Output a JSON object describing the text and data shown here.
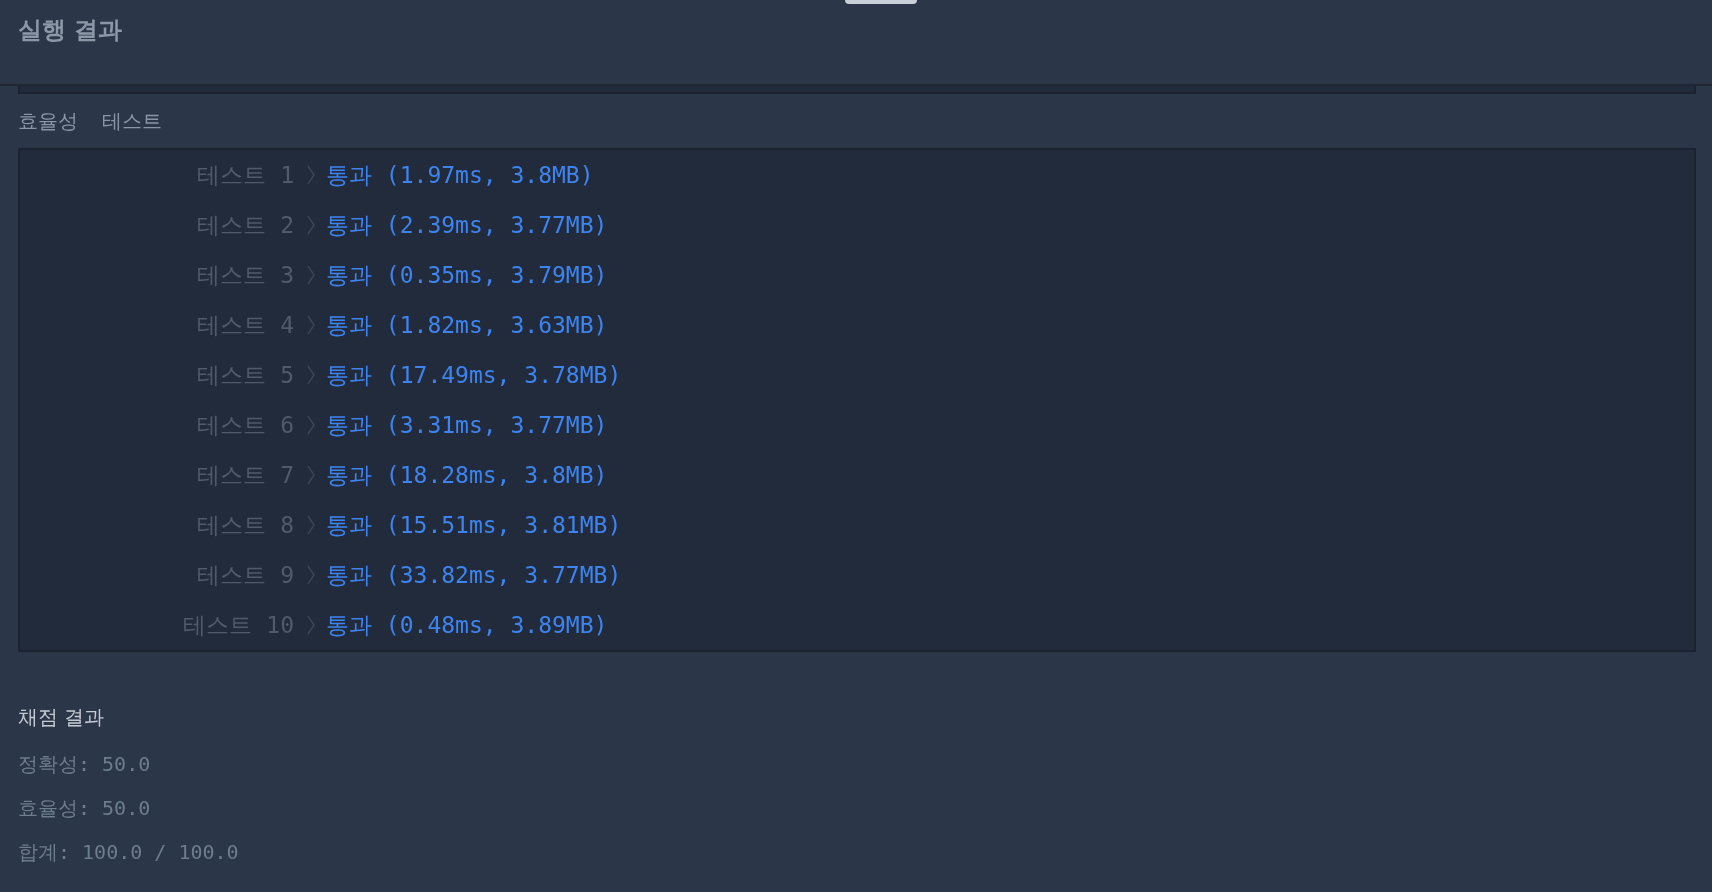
{
  "header": {
    "title": "실행 결과"
  },
  "section": {
    "title": "효율성  테스트"
  },
  "tests": [
    {
      "label": "테스트 1",
      "result": "통과 (1.97ms, 3.8MB)"
    },
    {
      "label": "테스트 2",
      "result": "통과 (2.39ms, 3.77MB)"
    },
    {
      "label": "테스트 3",
      "result": "통과 (0.35ms, 3.79MB)"
    },
    {
      "label": "테스트 4",
      "result": "통과 (1.82ms, 3.63MB)"
    },
    {
      "label": "테스트 5",
      "result": "통과 (17.49ms, 3.78MB)"
    },
    {
      "label": "테스트 6",
      "result": "통과 (3.31ms, 3.77MB)"
    },
    {
      "label": "테스트 7",
      "result": "통과 (18.28ms, 3.8MB)"
    },
    {
      "label": "테스트 8",
      "result": "통과 (15.51ms, 3.81MB)"
    },
    {
      "label": "테스트 9",
      "result": "통과 (33.82ms, 3.77MB)"
    },
    {
      "label": "테스트 10",
      "result": "통과 (0.48ms, 3.89MB)"
    }
  ],
  "grading": {
    "title": "채점 결과",
    "lines": [
      "정확성: 50.0",
      "효율성: 50.0",
      "합계: 100.0 / 100.0"
    ]
  }
}
